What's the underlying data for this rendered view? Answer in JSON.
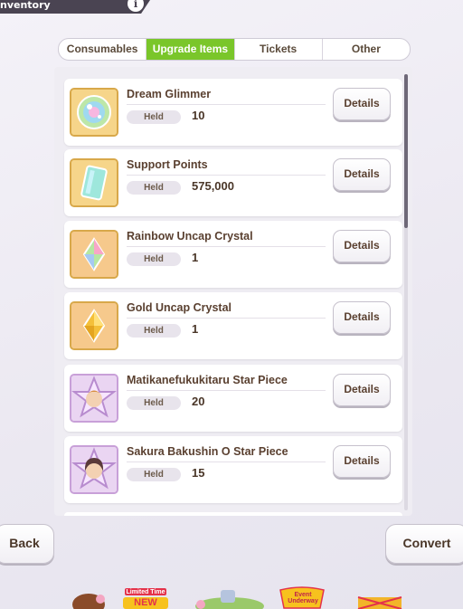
{
  "header": {
    "title": "nventory",
    "info_label": "i"
  },
  "tabs": [
    {
      "label": "Consumables",
      "active": false
    },
    {
      "label": "Upgrade Items",
      "active": true
    },
    {
      "label": "Tickets",
      "active": false
    },
    {
      "label": "Other",
      "active": false
    }
  ],
  "held_label": "Held",
  "details_label": "Details",
  "items": [
    {
      "name": "Dream Glimmer",
      "held": "10",
      "icon": "dream-glimmer-icon"
    },
    {
      "name": "Support Points",
      "held": "575,000",
      "icon": "support-points-icon"
    },
    {
      "name": "Rainbow Uncap Crystal",
      "held": "1",
      "icon": "rainbow-crystal-icon"
    },
    {
      "name": "Gold Uncap Crystal",
      "held": "1",
      "icon": "gold-crystal-icon"
    },
    {
      "name": "Matikanefukukitaru Star Piece",
      "held": "20",
      "icon": "star-piece-icon"
    },
    {
      "name": "Sakura Bakushin O Star Piece",
      "held": "15",
      "icon": "star-piece-icon"
    }
  ],
  "footer": {
    "back_label": "Back",
    "convert_label": "Convert"
  },
  "banners": {
    "limited": "Limited Time",
    "new": "NEW",
    "event": "Event Underway"
  },
  "colors": {
    "accent_green": "#7ac62a",
    "text_brown": "#5a4030",
    "header_dark": "#4a4452"
  }
}
